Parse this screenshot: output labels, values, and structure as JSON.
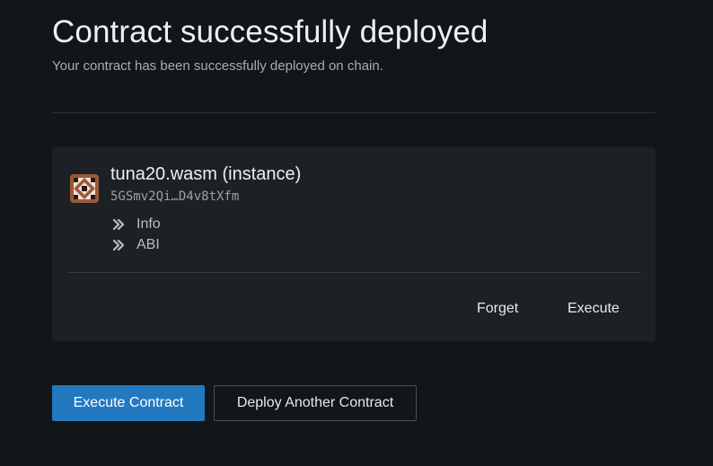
{
  "header": {
    "title": "Contract successfully deployed",
    "subtitle": "Your contract has been successfully deployed on chain."
  },
  "contract": {
    "name": "tuna20.wasm (instance)",
    "address": "5GSmv2Qi…D4v8tXfm",
    "expanders": [
      {
        "label": "Info",
        "icon": "double-chevron-right-icon"
      },
      {
        "label": "ABI",
        "icon": "double-chevron-right-icon"
      }
    ],
    "forget_label": "Forget",
    "execute_label": "Execute"
  },
  "actions": {
    "execute_contract_label": "Execute Contract",
    "deploy_another_label": "Deploy Another Contract"
  },
  "colors": {
    "background": "#131619",
    "card": "#1d2126",
    "primary": "#2379bf",
    "avatar_brown": "#9a5a3a"
  }
}
